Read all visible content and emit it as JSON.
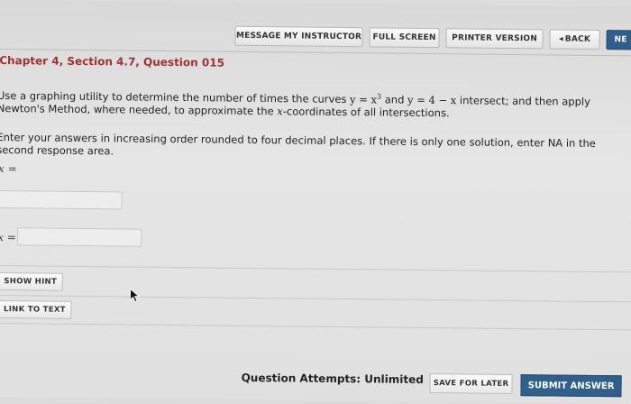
{
  "toolbar": {
    "message_label": "MESSAGE MY INSTRUCTOR",
    "fullscreen_label": "FULL SCREEN",
    "printer_label": "PRINTER VERSION",
    "back_label": "BACK",
    "back_icon": "◂",
    "next_label": "NE"
  },
  "question": {
    "title": "Chapter 4, Section 4.7, Question 015",
    "p1_a": "Use a graphing utility to determine the number of times the curves ",
    "eq1": "y = x",
    "eq1_sup": "3",
    "p1_and": " and ",
    "eq2": "y = 4 − x",
    "p1_b": " intersect; and then apply",
    "p1_c1": "Newton's Method, where needed, to approximate the ",
    "p1_x": "x",
    "p1_c2": "-coordinates of all intersections.",
    "p2_line1": "Enter your answers in increasing order rounded to four decimal places. If there is only one solution, enter NA in the",
    "p2_line2": "second response area."
  },
  "answers": [
    {
      "label": "x =",
      "value": ""
    },
    {
      "label": "x =",
      "value": ""
    }
  ],
  "buttons": {
    "hint_label": "SHOW HINT",
    "link_label": "LINK TO TEXT"
  },
  "footer": {
    "attempts": "Question Attempts: Unlimited",
    "save_label": "SAVE FOR LATER",
    "submit_label": "SUBMIT ANSWER"
  }
}
